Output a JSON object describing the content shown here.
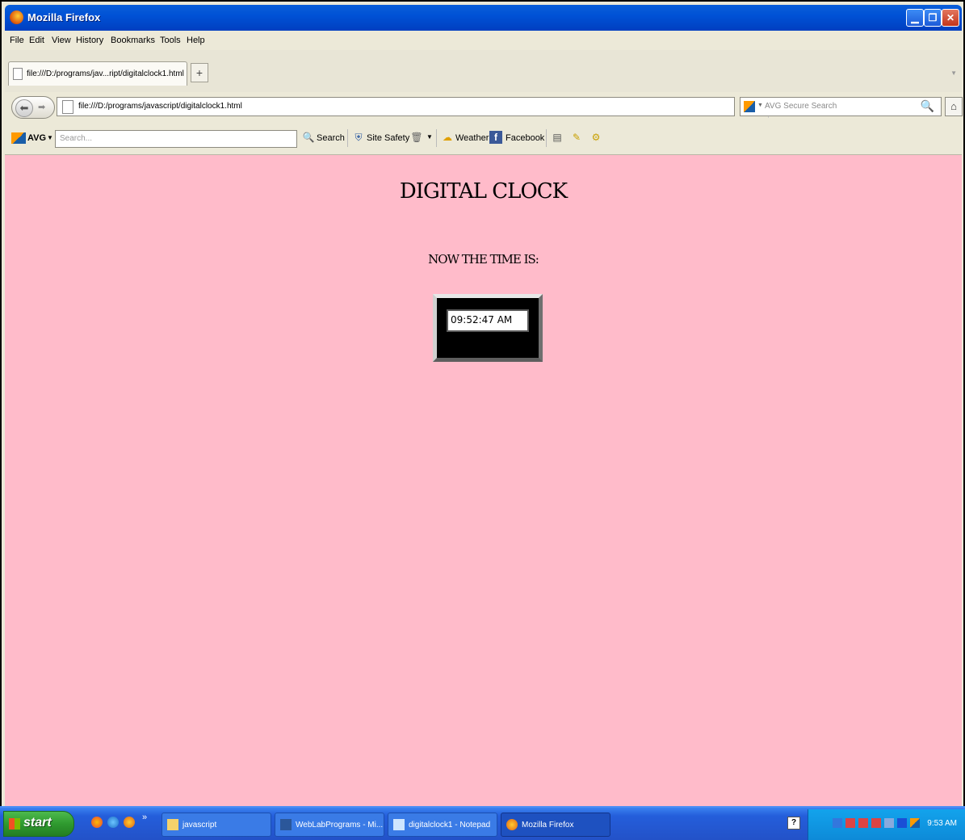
{
  "window": {
    "title": "Mozilla Firefox",
    "controls": [
      "minimize",
      "restore",
      "close"
    ]
  },
  "menu": [
    "File",
    "Edit",
    "View",
    "History",
    "Bookmarks",
    "Tools",
    "Help"
  ],
  "tabs": [
    {
      "label": "file:///D:/programs/jav...ript/digitalclock1.html"
    }
  ],
  "newtab_label": "+",
  "nav": {
    "url": "file:///D:/programs/javascript/digitalclock1.html",
    "search_placeholder": "AVG Secure Search"
  },
  "avg_toolbar": {
    "brand": "AVG",
    "search_placeholder": "Search...",
    "search_label": "Search",
    "site_safety_label": "Site Safety",
    "weather_label": "Weather",
    "facebook_label": "Facebook"
  },
  "page": {
    "heading": "DIGITAL CLOCK",
    "subheading": "NOW THE TIME IS:",
    "time_value": "09:52:47 AM",
    "background": "#ffbbca"
  },
  "taskbar": {
    "start_label": "start",
    "tasks": [
      {
        "label": "javascript",
        "icon": "folder-icon"
      },
      {
        "label": "WebLabPrograms - Mi...",
        "icon": "word-icon"
      },
      {
        "label": "digitalclock1 - Notepad",
        "icon": "notepad-icon"
      },
      {
        "label": "Mozilla Firefox",
        "icon": "firefox-icon",
        "active": true
      }
    ],
    "clock": "9:53 AM"
  }
}
